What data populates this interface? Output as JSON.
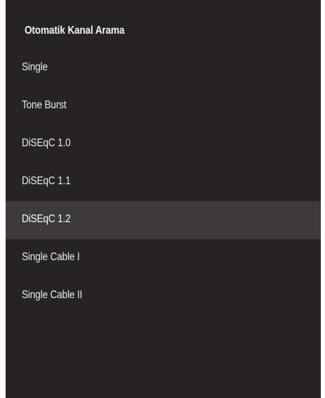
{
  "dialog": {
    "title": "Otomatik Kanal Arama",
    "items": [
      {
        "label": "Single",
        "selected": false
      },
      {
        "label": "Tone Burst",
        "selected": false
      },
      {
        "label": "DiSEqC 1.0",
        "selected": false
      },
      {
        "label": "DiSEqC 1.1",
        "selected": false
      },
      {
        "label": "DiSEqC 1.2",
        "selected": true
      },
      {
        "label": "Single Cable I",
        "selected": false
      },
      {
        "label": "Single Cable II",
        "selected": false
      }
    ]
  },
  "colors": {
    "panel_background": "#262322",
    "highlight_background": "#3d3a39",
    "text": "#f2f2f2"
  }
}
